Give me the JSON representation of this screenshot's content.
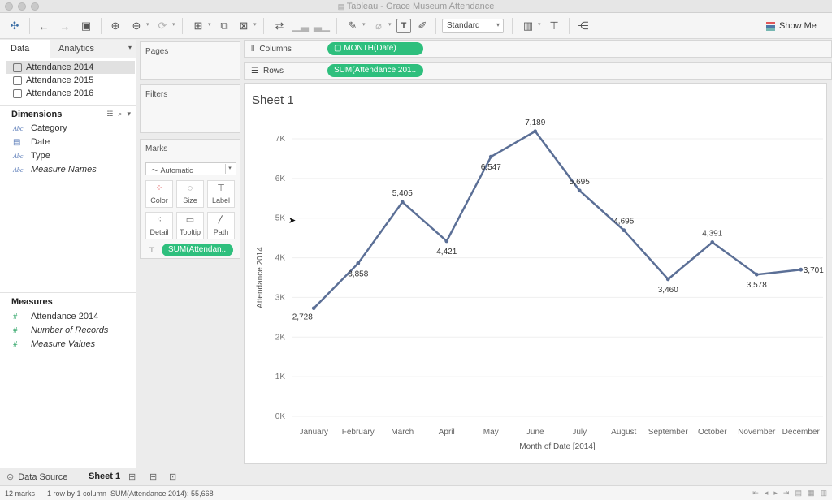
{
  "window": {
    "title": "Tableau - Grace Museum Attendance"
  },
  "toolbar": {
    "standard_select": "Standard",
    "show_me_label": "Show Me",
    "show_me_colors": [
      "#e15759",
      "#4e79a7",
      "#76b7b2"
    ]
  },
  "left_pane": {
    "tab_data": "Data",
    "tab_analytics": "Analytics",
    "datasources": [
      {
        "label": "Attendance 2014"
      },
      {
        "label": "Attendance 2015"
      },
      {
        "label": "Attendance 2016"
      }
    ],
    "dimensions_header": "Dimensions",
    "dimensions": [
      {
        "type": "Abc",
        "label": "Category"
      },
      {
        "type": "date",
        "label": "Date"
      },
      {
        "type": "Abc",
        "label": "Type"
      },
      {
        "type": "Abc",
        "label": "Measure Names"
      }
    ],
    "measures_header": "Measures",
    "measures": [
      {
        "label": "Attendance 2014"
      },
      {
        "label": "Number of Records"
      },
      {
        "label": "Measure Values"
      }
    ]
  },
  "cards": {
    "pages_title": "Pages",
    "filters_title": "Filters",
    "marks_title": "Marks",
    "marks_type": "Automatic",
    "mark_buttons": [
      "Color",
      "Size",
      "Label",
      "Detail",
      "Tooltip",
      "Path"
    ],
    "label_pill": "SUM(Attendan.."
  },
  "shelves": {
    "columns_label": "Columns",
    "columns_pill": "MONTH(Date)",
    "rows_label": "Rows",
    "rows_pill": "SUM(Attendance 201.."
  },
  "sheet": {
    "title": "Sheet 1"
  },
  "chart_data": {
    "type": "line",
    "title": "Sheet 1",
    "xlabel": "Month of Date [2014]",
    "ylabel": "Attendance 2014",
    "categories": [
      "January",
      "February",
      "March",
      "April",
      "May",
      "June",
      "July",
      "August",
      "September",
      "October",
      "November",
      "December"
    ],
    "series": [
      {
        "values": [
          2728,
          3858,
          5405,
          4421,
          6547,
          7189,
          5695,
          4695,
          3460,
          4391,
          3578,
          3701
        ]
      }
    ],
    "data_labels": [
      "2,728",
      "3,858",
      "5,405",
      "4,421",
      "6,547",
      "7,189",
      "5,695",
      "4,695",
      "3,460",
      "4,391",
      "3,578",
      "3,701"
    ],
    "yticks": [
      "0K",
      "1K",
      "2K",
      "3K",
      "4K",
      "5K",
      "6K",
      "7K"
    ],
    "ylim": [
      0,
      7000
    ],
    "line_color": "#5b6f96",
    "grid": true
  },
  "bottom": {
    "data_source_tab": "Data Source",
    "sheet_tab": "Sheet 1"
  },
  "status": {
    "marks": "12 marks",
    "rows_cols": "1 row by 1 column",
    "sum": "SUM(Attendance 2014): 55,668"
  }
}
